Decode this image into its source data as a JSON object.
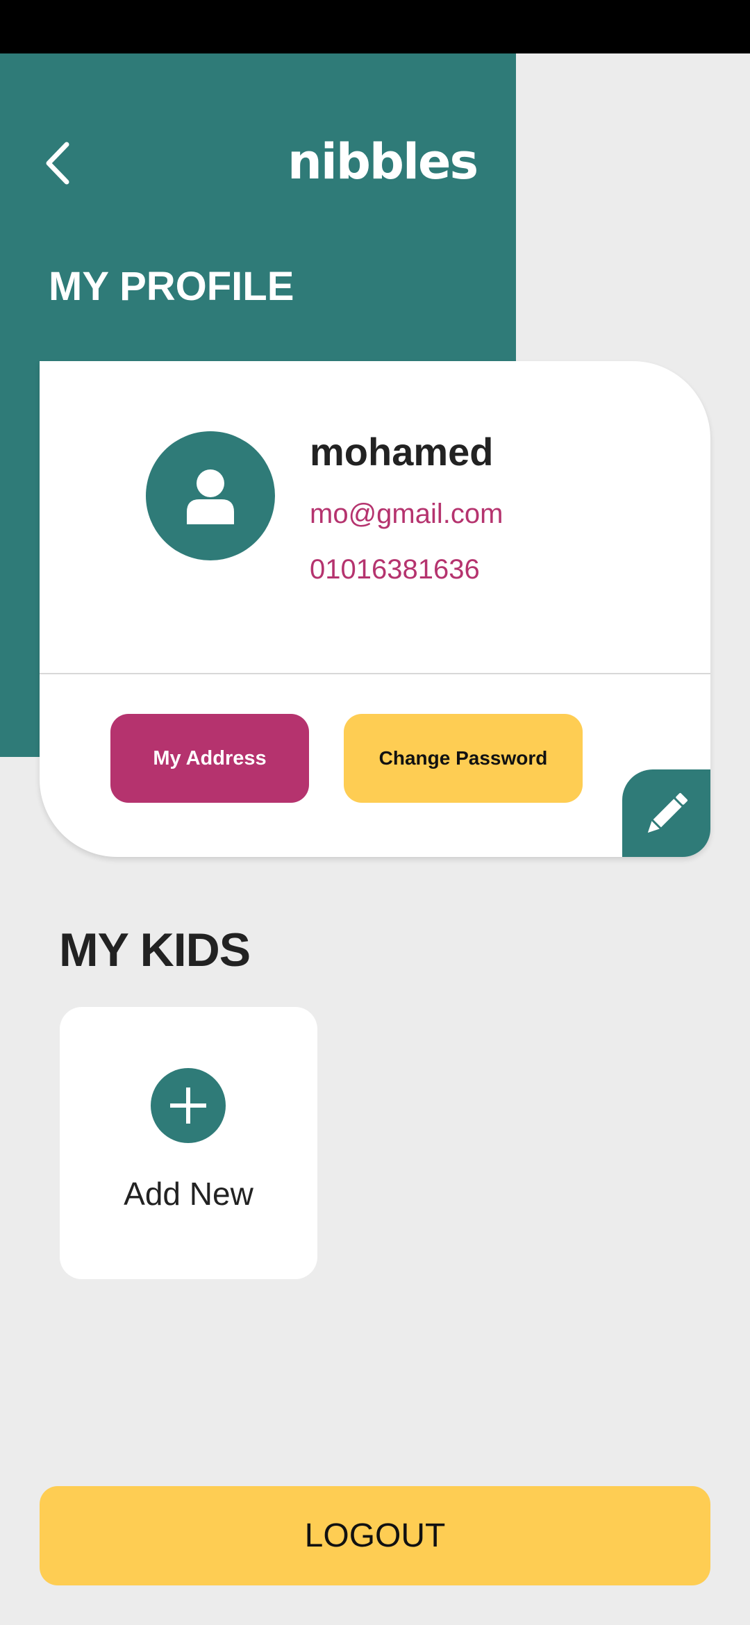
{
  "header": {
    "app_name": "nibbles",
    "page_title": "MY PROFILE"
  },
  "profile": {
    "name": "mohamed",
    "email": "mo@gmail.com",
    "phone": "01016381636",
    "address_button": "My Address",
    "change_password_button": "Change Password"
  },
  "kids": {
    "title": "MY KIDS",
    "add_label": "Add New"
  },
  "footer": {
    "logout_label": "LOGOUT"
  },
  "colors": {
    "teal": "#2f7b78",
    "magenta": "#b5336e",
    "yellow": "#fecd53",
    "background": "#ececec"
  },
  "icons": {
    "back": "chevron-left-icon",
    "avatar": "user-icon",
    "edit": "pencil-icon",
    "add": "plus-icon"
  }
}
